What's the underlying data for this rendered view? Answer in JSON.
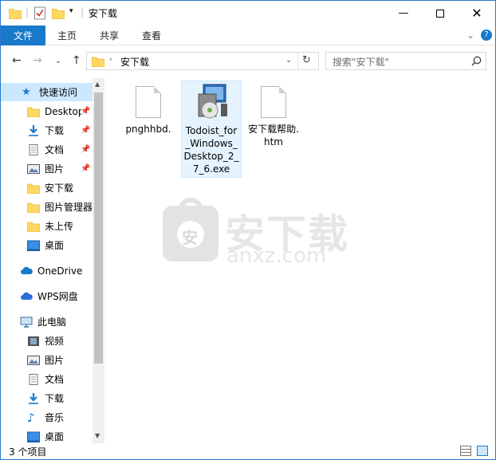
{
  "window": {
    "title": "安下载",
    "colors": {
      "accent": "#1979ca",
      "selection": "#cce8ff",
      "folder": "#ffd863"
    }
  },
  "ribbon": {
    "tabs": [
      "文件",
      "主页",
      "共享",
      "查看"
    ]
  },
  "address": {
    "path": "安下载",
    "search_placeholder": "搜索\"安下载\""
  },
  "nav": {
    "quick_access": "快速访问",
    "items": [
      {
        "label": "Desktop",
        "icon": "folder-icon",
        "pinned": true
      },
      {
        "label": "下载",
        "icon": "download-icon",
        "pinned": true
      },
      {
        "label": "文档",
        "icon": "document-icon",
        "pinned": true
      },
      {
        "label": "图片",
        "icon": "pictures-icon",
        "pinned": true
      },
      {
        "label": "安下载",
        "icon": "folder-icon",
        "pinned": false
      },
      {
        "label": "图片管理器",
        "icon": "folder-icon",
        "pinned": false
      },
      {
        "label": "未上传",
        "icon": "folder-icon",
        "pinned": false
      },
      {
        "label": "桌面",
        "icon": "desktop-icon",
        "pinned": false
      }
    ],
    "onedrive": "OneDrive",
    "wps": "WPS网盘",
    "this_pc": "此电脑",
    "pc_items": [
      {
        "label": "视频",
        "icon": "video-icon"
      },
      {
        "label": "图片",
        "icon": "pictures-icon"
      },
      {
        "label": "文档",
        "icon": "document-icon"
      },
      {
        "label": "下载",
        "icon": "download-icon"
      },
      {
        "label": "音乐",
        "icon": "music-icon"
      },
      {
        "label": "桌面",
        "icon": "desktop-icon"
      }
    ]
  },
  "files": [
    {
      "name": "pnghhbd.",
      "icon": "blank-file-icon"
    },
    {
      "name": "Todoist_for_Windows_Desktop_2_7_6.exe",
      "icon": "installer-icon"
    },
    {
      "name": "安下载帮助.htm",
      "icon": "html-file-icon"
    }
  ],
  "watermark": {
    "text": "安下载",
    "sub": "anxz.com",
    "badge": "安"
  },
  "status": {
    "count": "3 个项目"
  }
}
